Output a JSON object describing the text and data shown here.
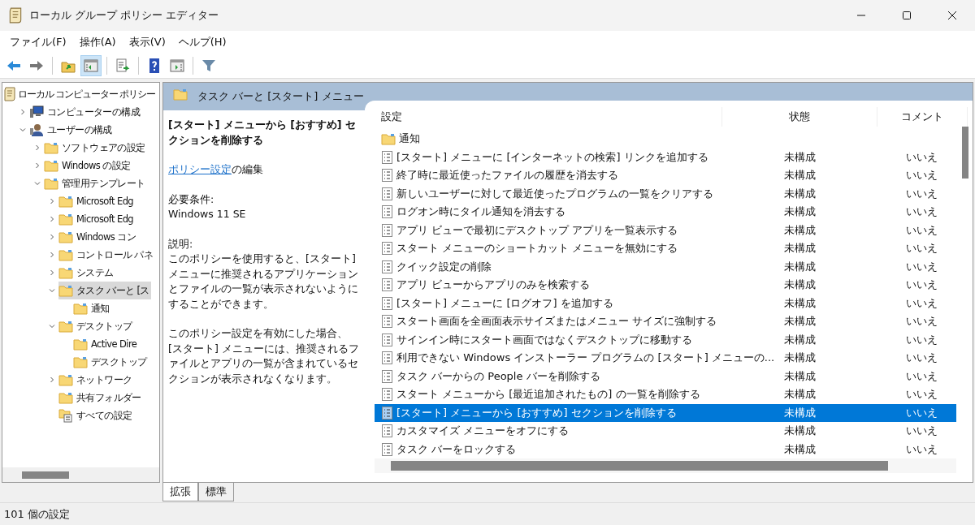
{
  "window": {
    "title": "ローカル グループ ポリシー エディター"
  },
  "menu": [
    "ファイル(F)",
    "操作(A)",
    "表示(V)",
    "ヘルプ(H)"
  ],
  "toolbar": [
    {
      "kind": "back",
      "pressed": false
    },
    {
      "kind": "forward",
      "pressed": false
    },
    {
      "kind": "sep"
    },
    {
      "kind": "up",
      "pressed": false
    },
    {
      "kind": "tree",
      "pressed": true
    },
    {
      "kind": "sep"
    },
    {
      "kind": "export",
      "pressed": false
    },
    {
      "kind": "sep"
    },
    {
      "kind": "help",
      "pressed": false
    },
    {
      "kind": "action",
      "pressed": false
    },
    {
      "kind": "sep"
    },
    {
      "kind": "filter",
      "pressed": false
    }
  ],
  "tree": {
    "label": "ローカル コンピューター ポリシー",
    "kind": "policy",
    "children": [
      {
        "label": "コンピューターの構成",
        "kind": "computer",
        "expanded": false,
        "selected": false
      },
      {
        "label": "ユーザーの構成",
        "kind": "user",
        "expanded": true,
        "selected": false,
        "children": [
          {
            "label": "ソフトウェアの設定",
            "kind": "folder",
            "expanded": false,
            "selected": false
          },
          {
            "label": "Windows の設定",
            "kind": "folder",
            "expanded": false,
            "selected": false
          },
          {
            "label": "管理用テンプレート",
            "kind": "folder",
            "expanded": true,
            "selected": false,
            "children": [
              {
                "label": "Microsoft Edg",
                "kind": "folder",
                "expanded": false,
                "selected": false
              },
              {
                "label": "Microsoft Edg",
                "kind": "folder",
                "expanded": false,
                "selected": false
              },
              {
                "label": "Windows コン",
                "kind": "folder",
                "expanded": false,
                "selected": false
              },
              {
                "label": "コントロール パネ",
                "kind": "folder",
                "expanded": false,
                "selected": false
              },
              {
                "label": "システム",
                "kind": "folder",
                "expanded": false,
                "selected": false
              },
              {
                "label": "タスク バーと [ス",
                "kind": "folder",
                "expanded": true,
                "selected": true,
                "children": [
                  {
                    "label": "通知",
                    "kind": "folder",
                    "selected": false
                  }
                ]
              },
              {
                "label": "デスクトップ",
                "kind": "folder",
                "expanded": true,
                "selected": false,
                "children": [
                  {
                    "label": "Active Dire",
                    "kind": "folder",
                    "selected": false
                  },
                  {
                    "label": "デスクトップ",
                    "kind": "folder",
                    "selected": false
                  }
                ]
              },
              {
                "label": "ネットワーク",
                "kind": "folder",
                "expanded": false,
                "selected": false
              },
              {
                "label": "共有フォルダー",
                "kind": "folder",
                "selected": false
              },
              {
                "label": "すべての設定",
                "kind": "settings",
                "selected": false
              }
            ]
          }
        ]
      }
    ]
  },
  "pane_header": {
    "title": "タスク バーと [スタート] メニュー"
  },
  "description": {
    "title": "[スタート] メニューから [おすすめ] セクションを削除する",
    "edit_link": "ポリシー設定",
    "edit_text": "の編集",
    "requirement_label": "必要条件:",
    "requirement": "Windows 11 SE",
    "explain_label": "説明:",
    "paragraphs": [
      "このポリシーを使用すると、[スタート] メニューに推奨されるアプリケーションとファイルの一覧が表示されないようにすることができます。",
      "このポリシー設定を有効にした場合、[スタート] メニューには、推奨されるファイルとアプリの一覧が含まれているセクションが表示されなくなります。"
    ]
  },
  "table": {
    "columns": [
      "設定",
      "状態",
      "コメント"
    ],
    "rows": [
      {
        "kind": "folder",
        "setting": "通知",
        "selected": false
      },
      {
        "kind": "policy",
        "setting": "[スタート] メニューに [インターネットの検索] リンクを追加する",
        "state": "未構成",
        "comment": "いいえ",
        "selected": false
      },
      {
        "kind": "policy",
        "setting": "終了時に最近使ったファイルの履歴を消去する",
        "state": "未構成",
        "comment": "いいえ",
        "selected": false
      },
      {
        "kind": "policy",
        "setting": "新しいユーザーに対して最近使ったプログラムの一覧をクリアする",
        "state": "未構成",
        "comment": "いいえ",
        "selected": false
      },
      {
        "kind": "policy",
        "setting": "ログオン時にタイル通知を消去する",
        "state": "未構成",
        "comment": "いいえ",
        "selected": false
      },
      {
        "kind": "policy",
        "setting": "アプリ ビューで最初にデスクトップ アプリを一覧表示する",
        "state": "未構成",
        "comment": "いいえ",
        "selected": false
      },
      {
        "kind": "policy",
        "setting": "スタート メニューのショートカット メニューを無効にする",
        "state": "未構成",
        "comment": "いいえ",
        "selected": false
      },
      {
        "kind": "policy",
        "setting": "クイック設定の削除",
        "state": "未構成",
        "comment": "いいえ",
        "selected": false
      },
      {
        "kind": "policy",
        "setting": "アプリ ビューからアプリのみを検索する",
        "state": "未構成",
        "comment": "いいえ",
        "selected": false
      },
      {
        "kind": "policy",
        "setting": "[スタート] メニューに [ログオフ] を追加する",
        "state": "未構成",
        "comment": "いいえ",
        "selected": false
      },
      {
        "kind": "policy",
        "setting": "スタート画面を全画面表示サイズまたはメニュー サイズに強制する",
        "state": "未構成",
        "comment": "いいえ",
        "selected": false
      },
      {
        "kind": "policy",
        "setting": "サインイン時にスタート画面ではなくデスクトップに移動する",
        "state": "未構成",
        "comment": "いいえ",
        "selected": false
      },
      {
        "kind": "policy",
        "setting": "利用できない Windows インストーラー プログラムの [スタート] メニューの...",
        "state": "未構成",
        "comment": "いいえ",
        "selected": false
      },
      {
        "kind": "policy",
        "setting": "タスク バーからの People バーを削除する",
        "state": "未構成",
        "comment": "いいえ",
        "selected": false
      },
      {
        "kind": "policy",
        "setting": "スタート メニューから [最近追加されたもの] の一覧を削除する",
        "state": "未構成",
        "comment": "いいえ",
        "selected": false
      },
      {
        "kind": "policy",
        "setting": "[スタート] メニューから [おすすめ] セクションを削除する",
        "state": "未構成",
        "comment": "いいえ",
        "selected": true
      },
      {
        "kind": "policy",
        "setting": "カスタマイズ メニューをオフにする",
        "state": "未構成",
        "comment": "いいえ",
        "selected": false
      },
      {
        "kind": "policy",
        "setting": "タスク バーをロックする",
        "state": "未構成",
        "comment": "いいえ",
        "selected": false
      }
    ]
  },
  "tabs": [
    {
      "label": "拡張",
      "selected": true
    },
    {
      "label": "標準",
      "selected": false
    }
  ],
  "status_bar": "101 個の設定"
}
